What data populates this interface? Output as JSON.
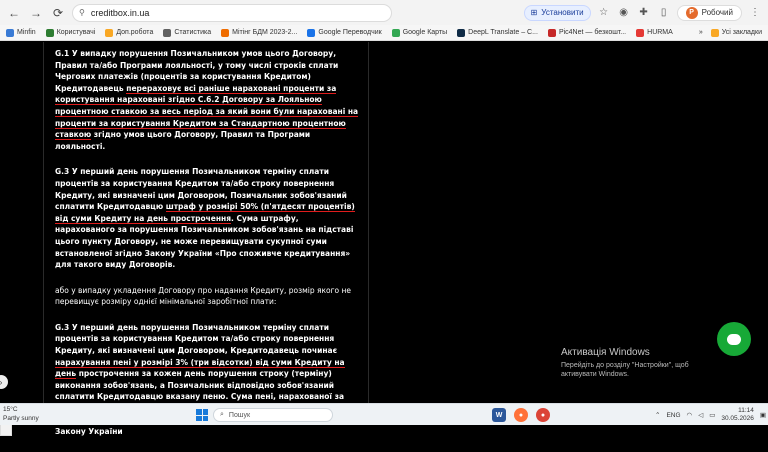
{
  "browser": {
    "url": "creditbox.in.ua",
    "install_label": "Установити",
    "profile_label": "Робочий",
    "profile_initial": "Р"
  },
  "bookmarks": {
    "items": [
      {
        "label": "Minfin",
        "color": "#3a7bd5"
      },
      {
        "label": "Користувачі",
        "color": "#2e7d32"
      },
      {
        "label": "Доп.робота",
        "color": "#f9a825"
      },
      {
        "label": "Статистика",
        "color": "#616161"
      },
      {
        "label": "Мітінг БДМ 2023-2...",
        "color": "#ef6c00"
      },
      {
        "label": "Google Переводчик",
        "color": "#1a73e8"
      },
      {
        "label": "Google Карты",
        "color": "#34a853"
      },
      {
        "label": "DeepL Translate – С...",
        "color": "#0f2b46"
      },
      {
        "label": "Pic4Net — безкошт...",
        "color": "#c62828"
      },
      {
        "label": "HURMA",
        "color": "#e53935"
      }
    ],
    "all_bookmarks_label": "Усі закладки"
  },
  "document": {
    "p1": "G.1 У випадку порушення Позичальником умов цього Договору, Правил та/або Програми лояльності, у тому числі строків сплати Чергових платежів (процентів за користування Кредитом) Кредитодавець ",
    "p1_u": "перераховує всі раніше нараховані проценти за користування нараховані згідно С.6.2 Договору за Лояльною процентною ставкою за весь період за який вони були нараховані на проценти за користування Кредитом за Стандартною процентною ставкою",
    "p1_end": " згідно умов цього Договору, Правил та Програми лояльності.",
    "p2": "G.3 У перший день порушення Позичальником терміну сплати процентів за користування Кредитом та/або строку повернення Кредиту, які визначені цим Договором, Позичальник зобов'язаний сплатити Кредитодавцю ",
    "p2_u": "штраф у розмірі 50% (п'ятдесят процентів) від суми Кредиту на день прострочення",
    "p2_end": ". Сума штрафу, нарахованого за порушення Позичальником зобов'язань на підставі цього пункту Договору, не може перевищувати сукупної суми встановленої згідно Закону України «Про споживче кредитування» для такого виду Договорів.",
    "p3": "або у випадку укладення Договору про надання Кредиту, розмір якого не перевищує розміру однієї мінімальної заробітної плати:",
    "p4": "G.3 У перший день порушення Позичальником терміну сплати процентів за користування Кредитом та/або строку повернення Кредиту, які визначені цим Договором, Кредитодавець починає ",
    "p4_u": "нарахування пені у розмірі 3% (три відсотки) від суми Кредиту на день",
    "p4_end": " прострочення за кожен день порушення строку (терміну) виконання зобов'язань, а Позичальник відповідно зобов'язаний сплатити Кредитодавцю вказану пеню. Сума пені, нарахованої за порушення Позичальником зобов'язань на підставі цього пункту Договору, не може перевищувати сукупної суми встановленої згідно Закону України"
  },
  "activation": {
    "title": "Активація Windows",
    "text": "Перейдіть до розділу \"Настройки\", щоб активувати Windows."
  },
  "taskbar": {
    "temperature": "15°C",
    "weather": "Partly sunny",
    "search_placeholder": "Пошук",
    "language": "ENG",
    "time": "11:14",
    "date": "30.05.2026"
  }
}
